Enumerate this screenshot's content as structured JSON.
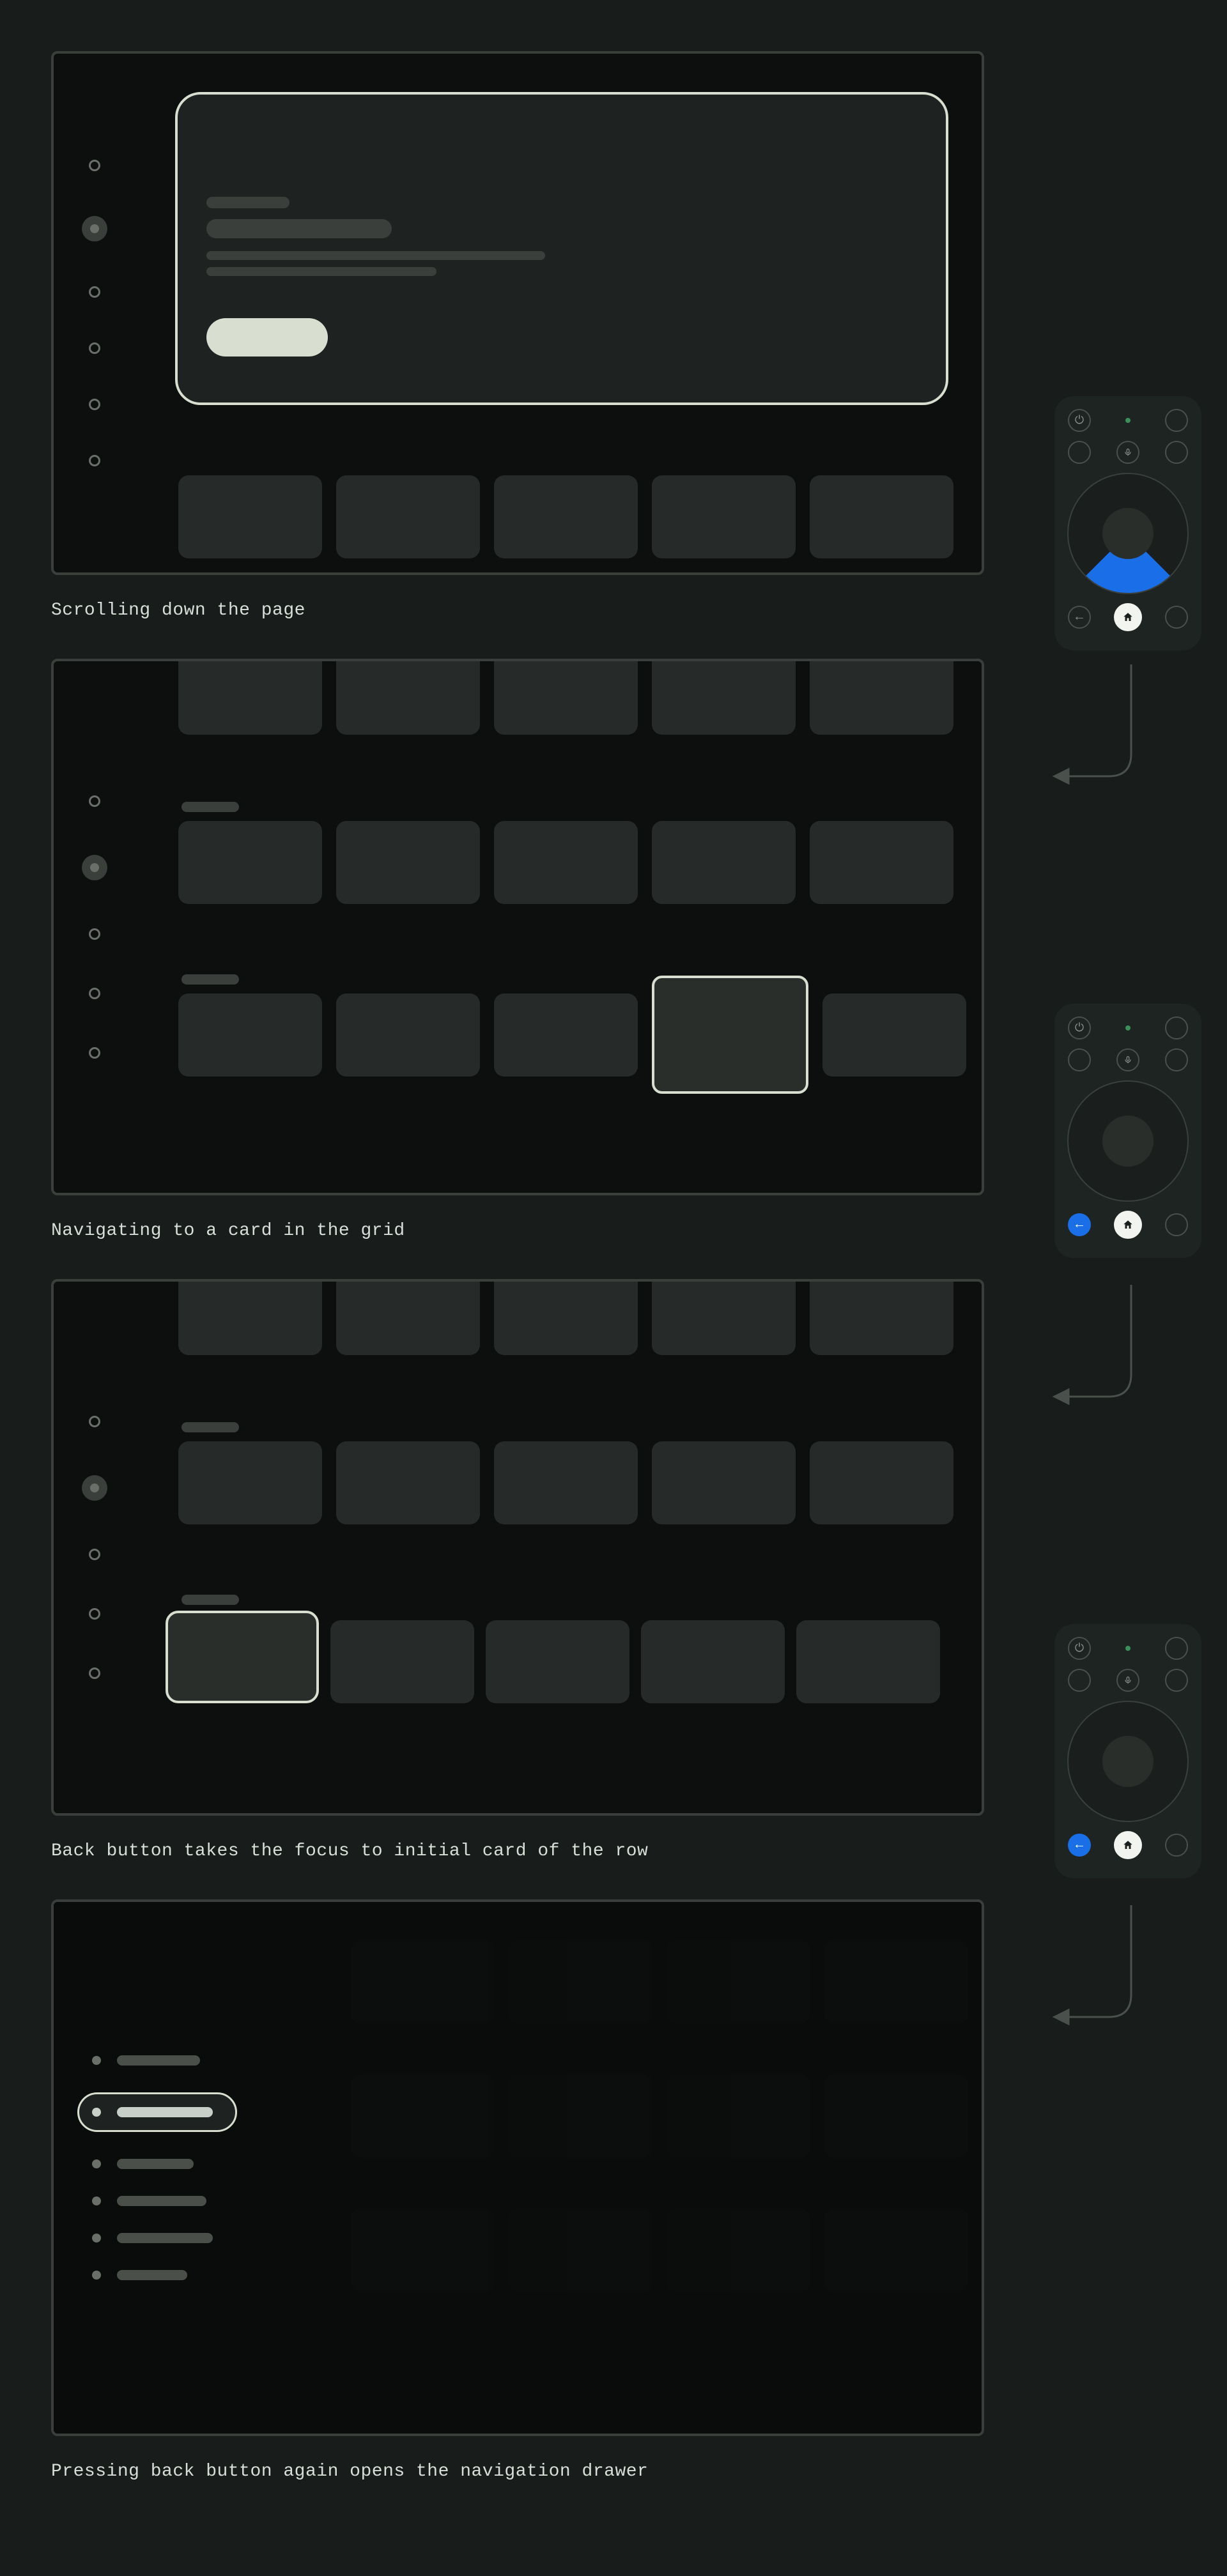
{
  "steps": {
    "s1": {
      "caption": "Scrolling down the page"
    },
    "s2": {
      "caption": "Navigating to a card in the grid"
    },
    "s3": {
      "caption": "Back button takes the focus to initial card of the row"
    },
    "s4": {
      "caption": "Pressing back button again opens the navigation drawer"
    }
  },
  "remote": {
    "power_glyph": "⏻",
    "mic_glyph": "🎤",
    "back_glyph": "←",
    "home_glyph": "⌂"
  }
}
